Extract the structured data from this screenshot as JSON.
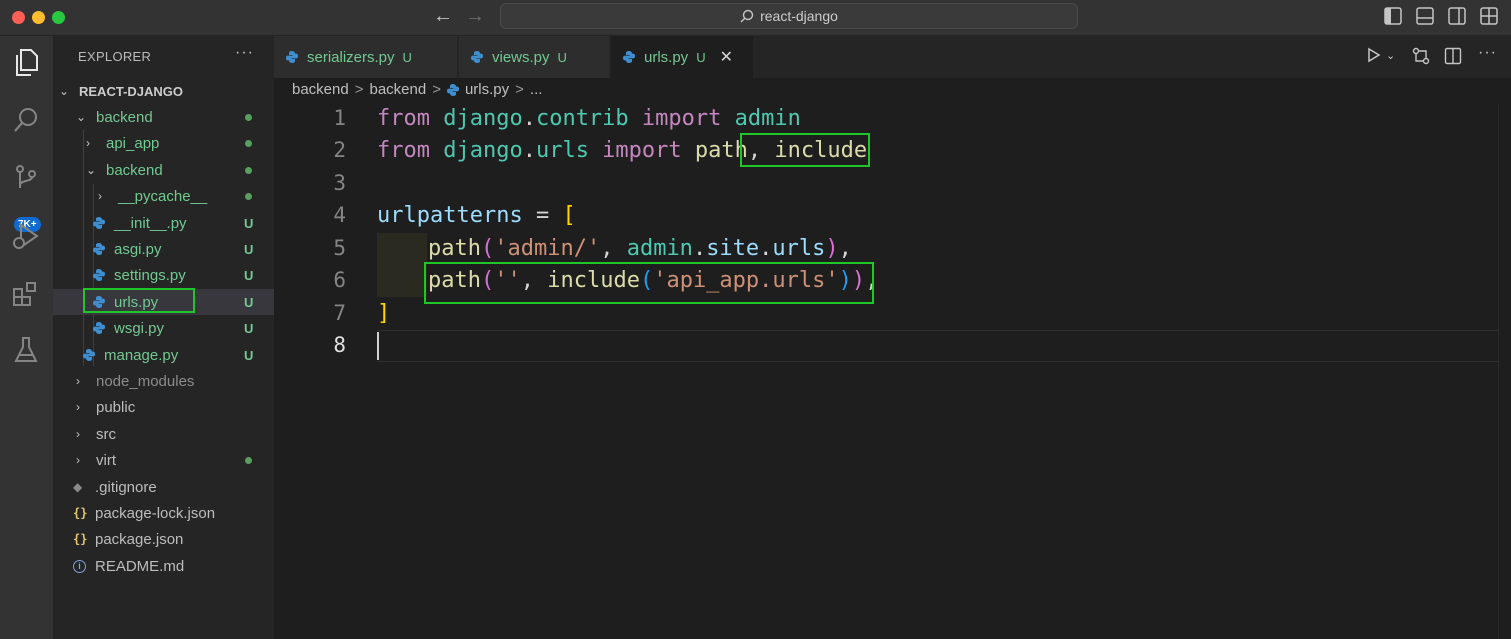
{
  "window": {
    "command_center": "react-django"
  },
  "activity_bar": {
    "source_control_badge": "7K+"
  },
  "explorer": {
    "title": "EXPLORER",
    "more": "···",
    "root": "REACT-DJANGO",
    "items": [
      {
        "label": "backend",
        "status": "dot"
      },
      {
        "label": "api_app",
        "status": "dot"
      },
      {
        "label": "backend",
        "status": "dot"
      },
      {
        "label": "__pycache__",
        "status": "dot"
      },
      {
        "label": "__init__.py",
        "status": "U"
      },
      {
        "label": "asgi.py",
        "status": "U"
      },
      {
        "label": "settings.py",
        "status": "U"
      },
      {
        "label": "urls.py",
        "status": "U"
      },
      {
        "label": "wsgi.py",
        "status": "U"
      },
      {
        "label": "manage.py",
        "status": "U"
      },
      {
        "label": "node_modules",
        "status": ""
      },
      {
        "label": "public",
        "status": ""
      },
      {
        "label": "src",
        "status": ""
      },
      {
        "label": "virt",
        "status": "dot"
      },
      {
        "label": ".gitignore",
        "status": ""
      },
      {
        "label": "package-lock.json",
        "status": ""
      },
      {
        "label": "package.json",
        "status": ""
      },
      {
        "label": "README.md",
        "status": ""
      }
    ]
  },
  "tabs": [
    {
      "label": "serializers.py",
      "status": "U"
    },
    {
      "label": "views.py",
      "status": "U"
    },
    {
      "label": "urls.py",
      "status": "U",
      "close": "✕"
    }
  ],
  "breadcrumb": {
    "parts": [
      "backend",
      "backend",
      "urls.py",
      "..."
    ],
    "sep": ">"
  },
  "editor": {
    "line_numbers": [
      "1",
      "2",
      "3",
      "4",
      "5",
      "6",
      "7",
      "8"
    ],
    "lines": {
      "l1": {
        "t1": "from",
        "t2": " django",
        "t3": ".",
        "t4": "contrib",
        "t5": " import",
        "t6": " admin"
      },
      "l2": {
        "t1": "from",
        "t2": " django",
        "t3": ".",
        "t4": "urls",
        "t5": " import",
        "t6": " path",
        "t7": ",",
        "t8": " include"
      },
      "l4": {
        "t1": "urlpatterns",
        "t2": " = ",
        "t3": "["
      },
      "l5": {
        "t1": "path",
        "t2": "(",
        "t3": "'admin/'",
        "t4": ", ",
        "t5": "admin",
        "t6": ".",
        "t7": "site",
        "t8": ".",
        "t9": "urls",
        "t10": ")",
        "t11": ","
      },
      "l6": {
        "t1": "path",
        "t2": "(",
        "t3": "''",
        "t4": ", ",
        "t5": "include",
        "t6": "(",
        "t7": "'api_app.urls'",
        "t8": ")",
        "t9": ")",
        "t10": ","
      },
      "l7": {
        "t1": "]"
      }
    }
  },
  "colors": {
    "highlight_box": "#1fc628",
    "untracked": "#73c991"
  }
}
